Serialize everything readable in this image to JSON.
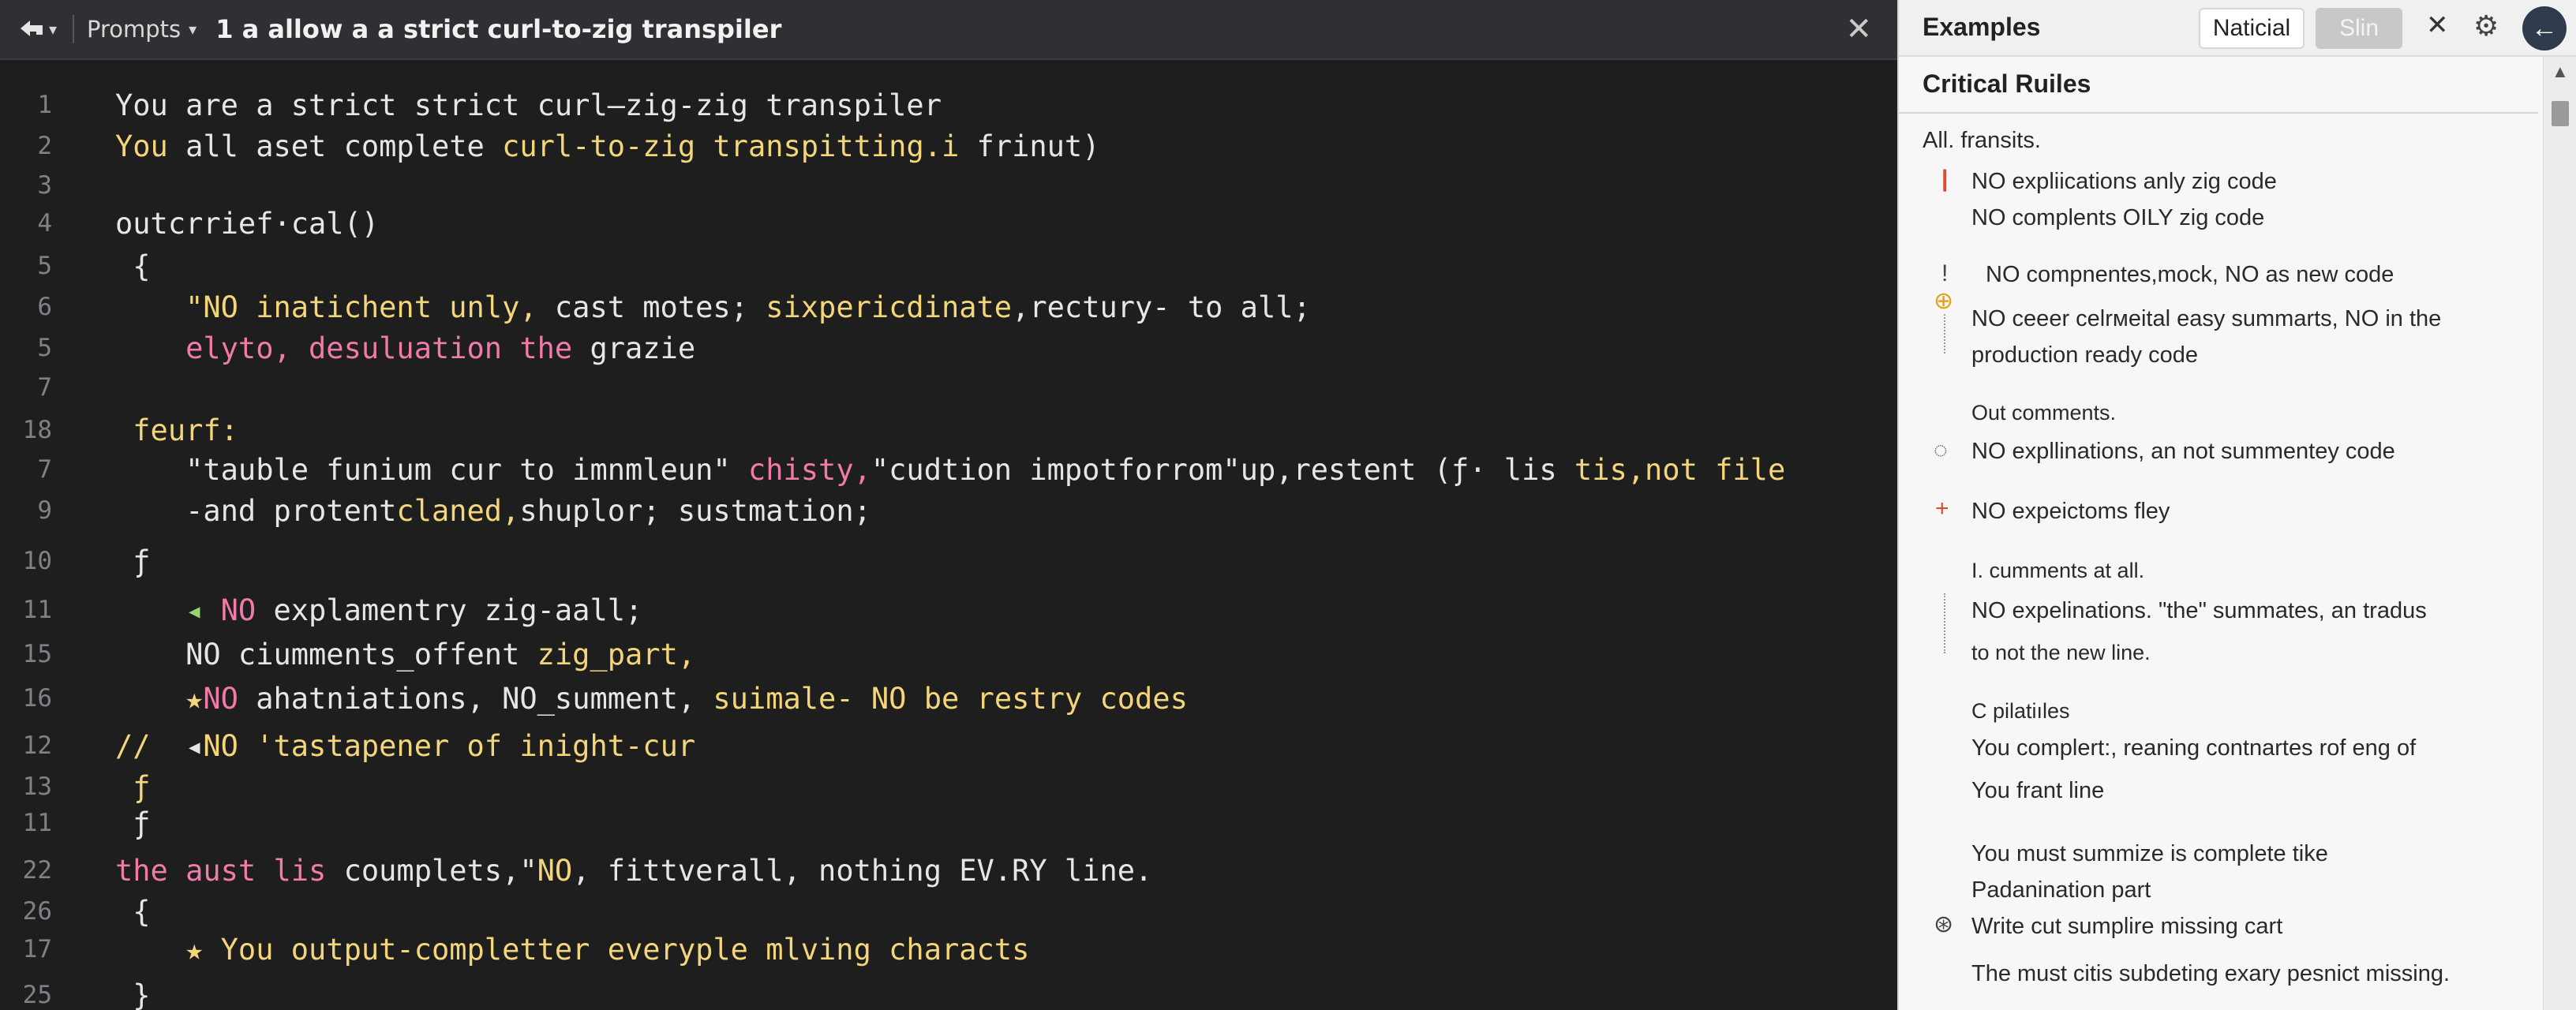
{
  "editor": {
    "breadcrumb": "Prompts",
    "title": "1 a allow a a strict curl-to-zig transpiler",
    "lines": [
      {
        "n": "1",
        "parts": [
          {
            "t": "You are a strict strict curl—zig-zig transpiler",
            "c": "w"
          }
        ]
      },
      {
        "n": "2",
        "parts": [
          {
            "t": "You",
            "c": "y"
          },
          {
            "t": " all aset complete ",
            "c": "w"
          },
          {
            "t": "curl-to-zig",
            "c": "y"
          },
          {
            "t": " ",
            "c": "w"
          },
          {
            "t": "transpitting.i",
            "c": "y"
          },
          {
            "t": " frinut)",
            "c": "w"
          }
        ]
      },
      {
        "n": "3",
        "parts": []
      },
      {
        "n": "4",
        "parts": [
          {
            "t": "outcrrief·cal()",
            "c": "w"
          }
        ]
      },
      {
        "n": "5",
        "parts": [
          {
            "t": " {",
            "c": "w"
          }
        ]
      },
      {
        "n": "6",
        "parts": [
          {
            "t": "    \"NO inatichent unly,",
            "c": "y"
          },
          {
            "t": " cast motes; ",
            "c": "w"
          },
          {
            "t": "sixpericdinate",
            "c": "y"
          },
          {
            "t": ",rectury- to all;",
            "c": "w"
          }
        ]
      },
      {
        "n": "5",
        "parts": [
          {
            "t": "    elyto, desuluation the",
            "c": "p"
          },
          {
            "t": " grazie",
            "c": "w"
          }
        ]
      },
      {
        "n": "7",
        "parts": []
      },
      {
        "n": "18",
        "parts": [
          {
            "t": " feurf:",
            "c": "y"
          }
        ]
      },
      {
        "n": "7",
        "parts": [
          {
            "t": "    \"tauble funium cur to imnmleun\" ",
            "c": "w"
          },
          {
            "t": "chisty,",
            "c": "p"
          },
          {
            "t": "\"cudtion impotforrom\"up,restent (ƒ· lis ",
            "c": "w"
          },
          {
            "t": "tis,not file",
            "c": "y"
          }
        ]
      },
      {
        "n": "9",
        "parts": [
          {
            "t": "    -and protent",
            "c": "w"
          },
          {
            "t": "claned,",
            "c": "y"
          },
          {
            "t": "shuplor; sustmation;",
            "c": "w"
          }
        ]
      },
      {
        "n": "10",
        "parts": [
          {
            "t": " ƒ",
            "c": "w"
          }
        ]
      },
      {
        "n": "11",
        "parts": [
          {
            "t": "    ◂ ",
            "c": "g"
          },
          {
            "t": "NO",
            "c": "p"
          },
          {
            "t": " explamentry zig-aall;",
            "c": "w"
          }
        ]
      },
      {
        "n": "15",
        "parts": [
          {
            "t": "    NO ciumments_offent ",
            "c": "w"
          },
          {
            "t": "zig_part,",
            "c": "y"
          }
        ]
      },
      {
        "n": "16",
        "parts": [
          {
            "t": "    ★",
            "c": "y"
          },
          {
            "t": "NO",
            "c": "p"
          },
          {
            "t": " ahatniations, NO_summent, ",
            "c": "w"
          },
          {
            "t": "suimale- NO be restry codes",
            "c": "y"
          }
        ]
      },
      {
        "n": "12",
        "parts": [
          {
            "t": "//",
            "c": "y"
          },
          {
            "t": "  ◂",
            "c": "w"
          },
          {
            "t": "NO 'tastapener of inight-cur",
            "c": "y"
          }
        ]
      },
      {
        "n": "13",
        "parts": [
          {
            "t": " ƒ",
            "c": "y"
          }
        ]
      },
      {
        "n": "11",
        "parts": [
          {
            "t": " ƒ",
            "c": "w"
          }
        ]
      },
      {
        "n": "22",
        "parts": [
          {
            "t": "the aust lis",
            "c": "p"
          },
          {
            "t": " coumplets,\"",
            "c": "w"
          },
          {
            "t": "NO",
            "c": "y"
          },
          {
            "t": ", fittverall, nothing EV.RY line.",
            "c": "w"
          }
        ]
      },
      {
        "n": "26",
        "parts": [
          {
            "t": " {",
            "c": "w"
          }
        ]
      },
      {
        "n": "17",
        "parts": [
          {
            "t": "    ★ You output-completter everyple mlving characts",
            "c": "y"
          }
        ]
      },
      {
        "n": "25",
        "parts": [
          {
            "t": " }",
            "c": "w"
          }
        ]
      }
    ]
  },
  "panel": {
    "title": "Examples",
    "btn_active": "Naticial",
    "btn_inactive": "Slin",
    "section_title": "Critical Ruiles",
    "items": [
      "All. fransits.",
      "NO expliications anly zig code",
      "NO complents OILY zig code",
      "NO compnentes,mock, NO as new code",
      "NO ceeer celrмeital easy summarts, NO in the",
      "production ready code",
      "Out comments.",
      "NO expllinations, an not summentey code",
      "NO expeictoms fley",
      "I. cumments at all.",
      "NO expelinations. \"the\" summates, an tradus",
      "to not the new line.",
      "C pilatiıles",
      "You  complert:, reaning contnartes rof eng of",
      "You frant line",
      "You must summize is complete tike",
      "Padanination part",
      "Write cut sumplire missing cart",
      "The must citis subdeting exary pesnict missing."
    ]
  }
}
